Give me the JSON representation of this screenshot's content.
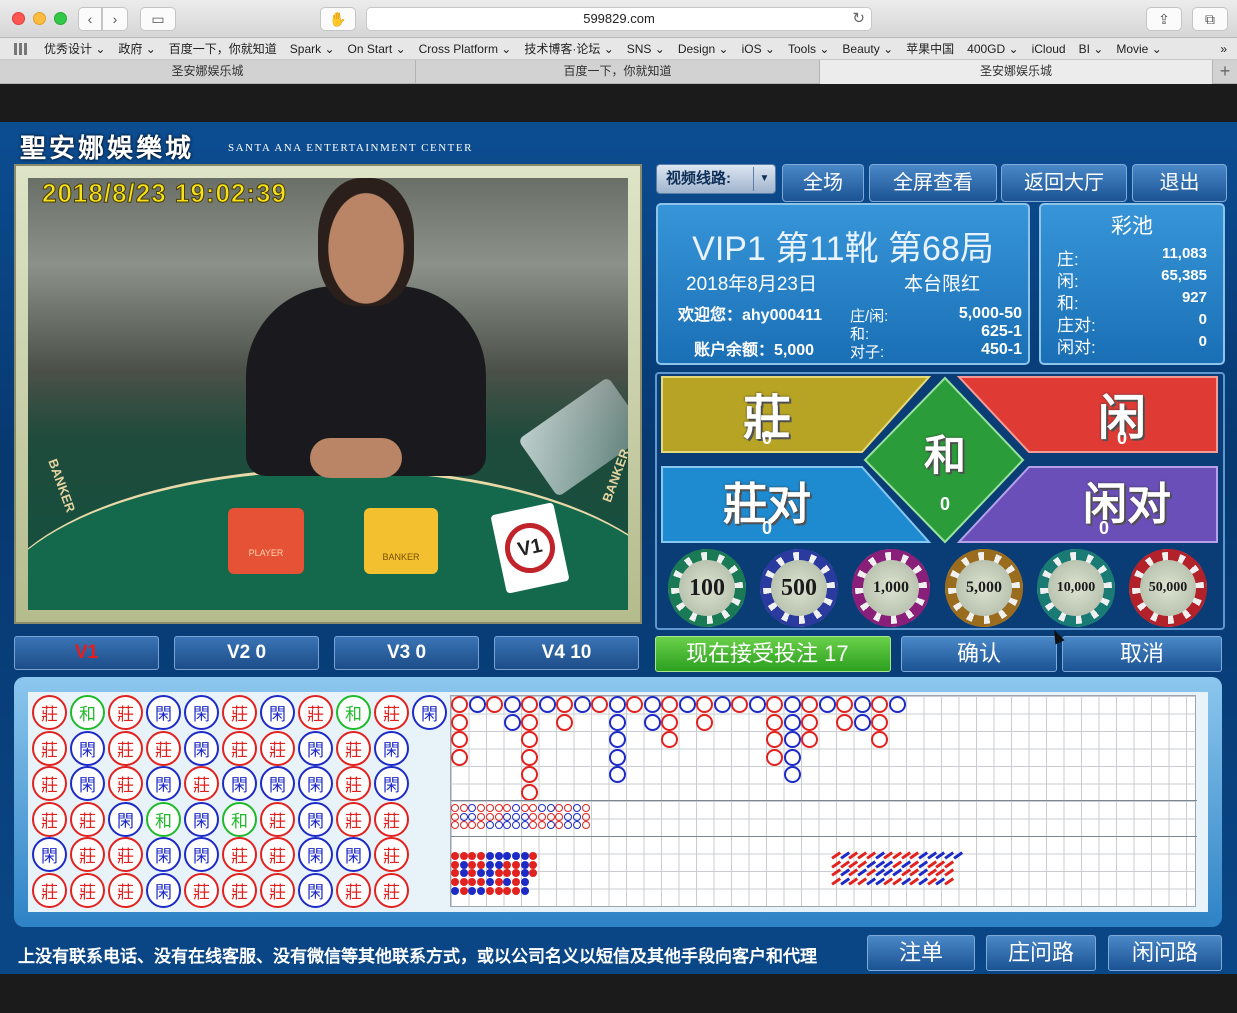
{
  "browser": {
    "url": "599829.com",
    "bookmarks": [
      "优秀设计 ⌄",
      "政府 ⌄",
      "百度一下，你就知道",
      "Spark ⌄",
      "On Start ⌄",
      "Cross Platform ⌄",
      "技术博客·论坛 ⌄",
      "SNS ⌄",
      "Design ⌄",
      "iOS ⌄",
      "Tools ⌄",
      "Beauty ⌄",
      "苹果中国",
      "400GD ⌄",
      "iCloud",
      "BI ⌄",
      "Movie ⌄"
    ],
    "tabs": [
      "圣安娜娱乐城",
      "百度一下，你就知道",
      "圣安娜娱乐城"
    ],
    "more": "»"
  },
  "brand": {
    "cn": "聖安娜娛樂城",
    "en": "SANTA ANA ENTERTAINMENT CENTER"
  },
  "video": {
    "timestamp": "2018/8/23 19:02:39",
    "marker_banker": "BANKER",
    "plaque_player": "PLAYER",
    "plaque_banker": "BANKER",
    "card": "V1"
  },
  "video_tabs": [
    "V1",
    "V2 0",
    "V3 0",
    "V4 10"
  ],
  "nav": {
    "line_label": "视频线路:",
    "caret": "▼",
    "full": "全场",
    "fullscreen": "全屏查看",
    "lobby": "返回大厅",
    "exit": "退出"
  },
  "info": {
    "title": "VIP1 第11靴 第68局",
    "date": "2018年8月23日",
    "limit_label": "本台限红",
    "welcome": "欢迎您：ahy000411",
    "balance": "账户余额：5,000",
    "limits": [
      {
        "k": "庄/闲:",
        "v": "5,000-50"
      },
      {
        "k": "和:",
        "v": "625-1"
      },
      {
        "k": "对子:",
        "v": "450-1"
      }
    ]
  },
  "pool": {
    "title": "彩池",
    "rows": [
      {
        "k": "庄:",
        "v": "11,083"
      },
      {
        "k": "闲:",
        "v": "65,385"
      },
      {
        "k": "和:",
        "v": "927"
      },
      {
        "k": "庄对:",
        "v": "0"
      },
      {
        "k": "闲对:",
        "v": "0"
      }
    ]
  },
  "bets": {
    "banker": {
      "label": "莊",
      "count": "0"
    },
    "player": {
      "label": "闲",
      "count": "0"
    },
    "tie": {
      "label": "和",
      "count": "0"
    },
    "banker_pair": {
      "label": "莊对",
      "count": "0"
    },
    "player_pair": {
      "label": "闲对",
      "count": "0"
    }
  },
  "chips": [
    "100",
    "500",
    "1,000",
    "5,000",
    "10,000",
    "50,000"
  ],
  "chip_colors": [
    "#1a7a55",
    "#2b3a9e",
    "#8a1f7a",
    "#9a6d1e",
    "#1a7a74",
    "#b3222b"
  ],
  "actions": {
    "accept": "现在接受投注  17",
    "confirm": "确认",
    "cancel": "取消"
  },
  "bead_labels": {
    "b": "莊",
    "p": "閑",
    "t": "和"
  },
  "bead_road": [
    [
      "b",
      "b",
      "b",
      "b",
      "p",
      "b"
    ],
    [
      "t",
      "p",
      "p",
      "b",
      "b",
      "b"
    ],
    [
      "b",
      "b",
      "b",
      "p",
      "b",
      "b"
    ],
    [
      "p",
      "b",
      "p",
      "t",
      "p",
      "p"
    ],
    [
      "p",
      "p",
      "b",
      "p",
      "p",
      "b"
    ],
    [
      "b",
      "b",
      "p",
      "t",
      "b",
      "b"
    ],
    [
      "p",
      "b",
      "p",
      "b",
      "b",
      "b"
    ],
    [
      "b",
      "p",
      "p",
      "p",
      "p",
      "p"
    ],
    [
      "t",
      "b",
      "b",
      "b",
      "p",
      "b"
    ],
    [
      "b",
      "p",
      "p",
      "b",
      "b",
      "b"
    ],
    [
      "p"
    ]
  ],
  "ticker": "上没有联系电话、没有在线客服、没有微信等其他联系方式，或以公司名义以短信及其他手段向客户和代理",
  "bottom": {
    "bet_record": "注单",
    "banker_ask": "庄问路",
    "player_ask": "闲问路"
  },
  "colors": {
    "banker": "#e2221f",
    "player": "#1d2ac6",
    "tie": "#1fba2a",
    "accept": "#3bb52a"
  }
}
